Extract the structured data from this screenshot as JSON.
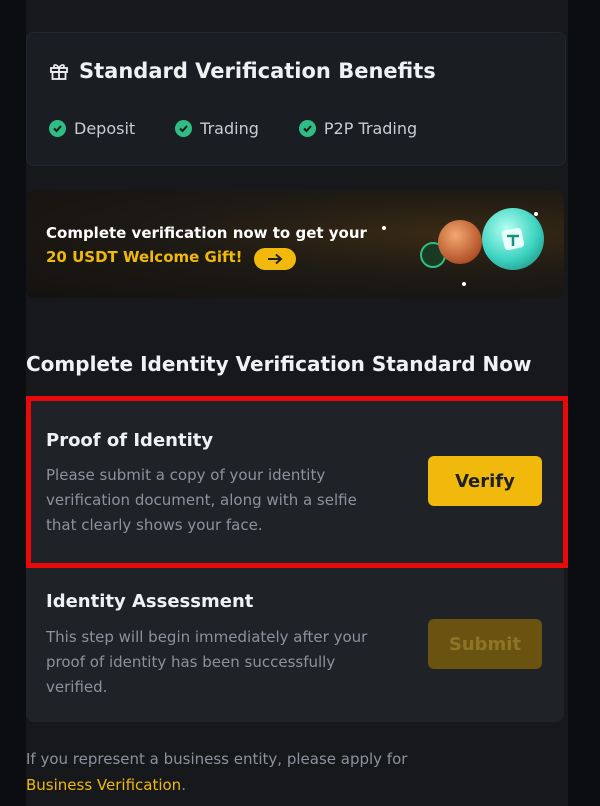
{
  "benefits": {
    "title": "Standard Verification Benefits",
    "icon": "gift-icon",
    "items": [
      {
        "label": "Deposit",
        "icon": "check-circle-icon"
      },
      {
        "label": "Trading",
        "icon": "check-circle-icon"
      },
      {
        "label": "P2P Trading",
        "icon": "check-circle-icon"
      }
    ]
  },
  "promo": {
    "line1": "Complete verification now to get your",
    "line2": "20 USDT Welcome Gift!",
    "arrow_icon": "arrow-right-icon"
  },
  "section": {
    "title": "Complete Identity Verification Standard Now"
  },
  "steps": [
    {
      "title": "Proof of Identity",
      "description": "Please submit a copy of your identity verification document, along with a selfie that clearly shows your face.",
      "button": "Verify",
      "button_state": "enabled"
    },
    {
      "title": "Identity Assessment",
      "description": "This step will begin immediately after your proof of identity has been successfully verified.",
      "button": "Submit",
      "button_state": "disabled"
    }
  ],
  "footer": {
    "text": "If you represent a business entity, please apply for",
    "link": "Business Verification",
    "suffix": "."
  },
  "colors": {
    "accent": "#f0b90b",
    "success": "#2ebd85",
    "highlight": "#e80a0a",
    "background": "#16181c"
  }
}
